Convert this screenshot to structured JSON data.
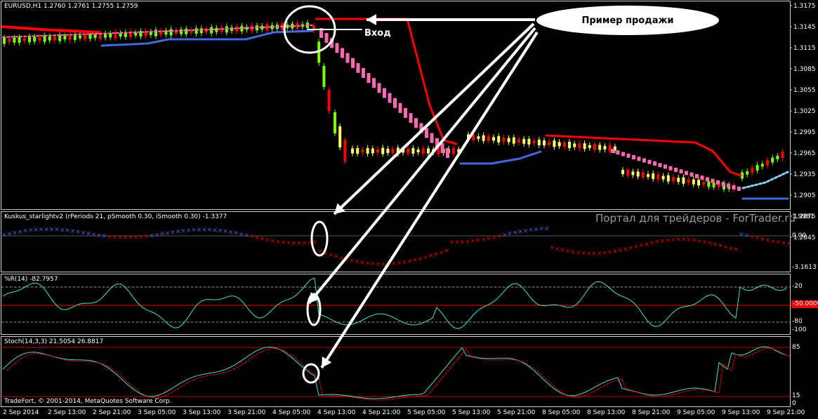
{
  "main_panel": {
    "header": "EURUSD,H1  1.2760 1.2761 1.2755 1.2759",
    "price_labels": [
      "1.3175",
      "1.3145",
      "1.3115",
      "1.3085",
      "1.3055",
      "1.3025",
      "1.2995",
      "1.2965",
      "1.2935",
      "1.2905",
      "1.2875",
      "1.2845"
    ],
    "annotation_bubble": "Пример продажи",
    "entry_label": "Вход"
  },
  "indicator1": {
    "header": "Kuskus_starlightv2  (rPeriods 21, pSmooth 0.30, iSmooth 0.30)  -1.3377",
    "labels": [
      "1.9981",
      "0.00",
      "-3.1613"
    ],
    "watermark": "Портал для трейдеров - ForTrader.ru"
  },
  "indicator2": {
    "header": "%R(14) -82.7957",
    "labels": [
      "-20",
      "-50.0000",
      "-80",
      "-100"
    ]
  },
  "indicator3": {
    "header": "Stoch(14,3,3) 21.5054 26.8817",
    "labels": [
      "85",
      "15",
      "0"
    ],
    "copyright": "TradeFort, © 2001-2014, MetaQuotes Software Corp."
  },
  "time_axis": [
    "2 Sep 2014",
    "2 Sep 13:00",
    "2 Sep 21:00",
    "3 Sep 05:00",
    "3 Sep 13:00",
    "3 Sep 21:00",
    "4 Sep 05:00",
    "4 Sep 13:00",
    "4 Sep 21:00",
    "5 Sep 05:00",
    "5 Sep 13:00",
    "5 Sep 21:00",
    "8 Sep 05:00",
    "8 Sep 13:00",
    "8 Sep 21:00",
    "9 Sep 05:00",
    "9 Sep 13:00",
    "9 Sep 21:00"
  ],
  "colors": {
    "background": "#000000",
    "bull_candle": "#7cfc00",
    "bear_candle": "#ff0000",
    "trend_red": "#ff0000",
    "trend_blue": "#4169e1",
    "pink_band": "#ff69b4",
    "cyan_line": "#40e0d0",
    "arrow": "#ffffff"
  }
}
